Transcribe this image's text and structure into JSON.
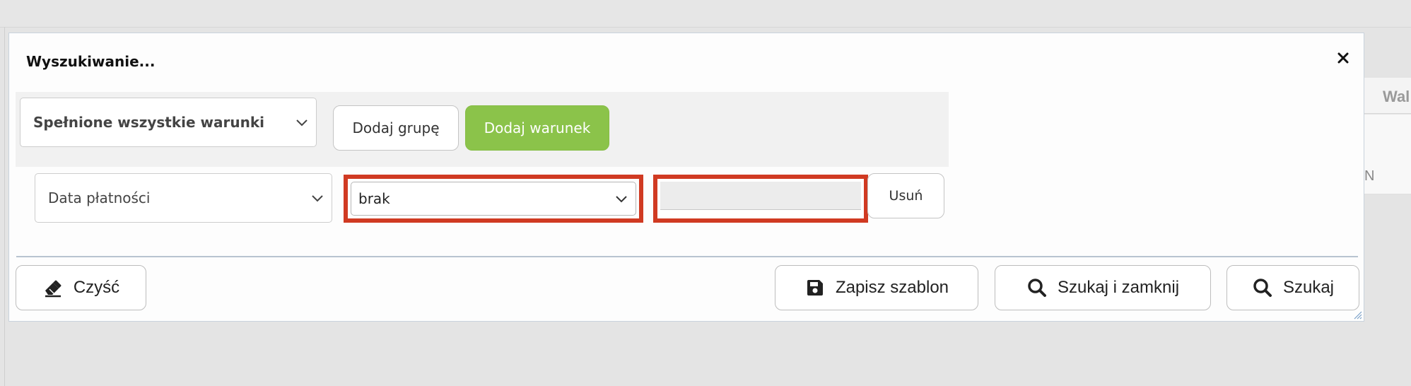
{
  "background": {
    "column_header": "Wal",
    "row_fragment": "N"
  },
  "dialog": {
    "title": "Wyszukiwanie...",
    "close_icon": "close-icon",
    "group": {
      "match_mode": "Spełnione wszystkie warunki",
      "add_group_label": "Dodaj grupę",
      "add_condition_label": "Dodaj warunek",
      "accent_color": "#8bc34a"
    },
    "condition": {
      "field": "Data płatności",
      "operator": "brak",
      "value": "",
      "remove_label": "Usuń",
      "highlight_color": "#d03a22"
    },
    "footer": {
      "clear_label": "Czyść",
      "clear_icon": "eraser-icon",
      "save_template_label": "Zapisz szablon",
      "save_template_icon": "floppy-disk-icon",
      "search_and_close_label": "Szukaj i zamknij",
      "search_and_close_icon": "search-icon",
      "search_label": "Szukaj",
      "search_icon": "search-icon"
    }
  }
}
